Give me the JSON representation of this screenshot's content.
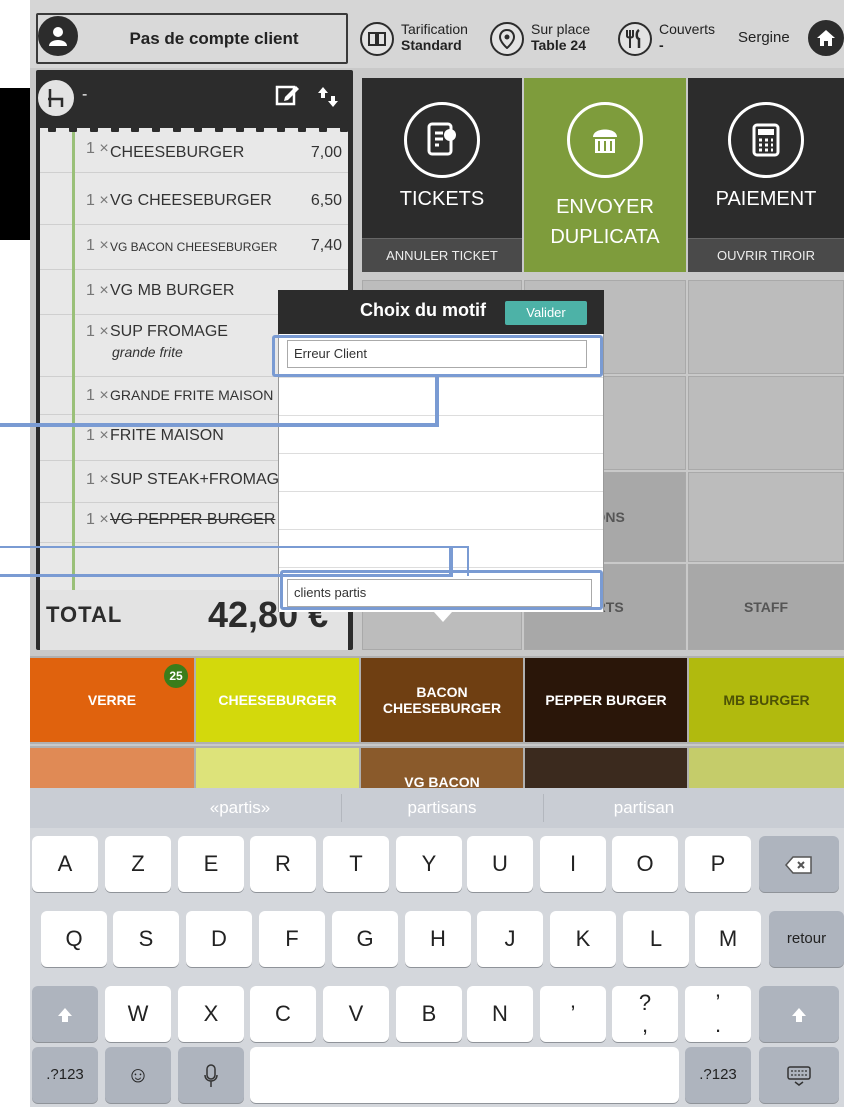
{
  "header": {
    "client_label": "Pas de compte client",
    "tarification_label": "Tarification",
    "tarification_value": "Standard",
    "service_label": "Sur place",
    "service_value": "Table 24",
    "couverts_label": "Couverts",
    "couverts_value": "-",
    "user_name": "Sergine"
  },
  "ticket": {
    "table_value": "-",
    "items": [
      {
        "qty": "1 ×",
        "name": "CHEESEBURGER",
        "price": "7,00"
      },
      {
        "qty": "1 ×",
        "name": "VG CHEESEBURGER",
        "price": "6,50"
      },
      {
        "qty": "1 ×",
        "name": "VG BACON CHEESEBURGER",
        "price": "7,40"
      },
      {
        "qty": "1 ×",
        "name": "VG MB BURGER",
        "price": ""
      },
      {
        "qty": "1 ×",
        "name": "SUP FROMAGE",
        "note": "grande frite",
        "price": ""
      },
      {
        "qty": "1 ×",
        "name": "GRANDE FRITE MAISON",
        "price": ""
      },
      {
        "qty": "1 ×",
        "name": "FRITE MAISON",
        "price": ""
      },
      {
        "qty": "1 ×",
        "name": "SUP STEAK+FROMAGE",
        "price": ""
      },
      {
        "qty": "1 ×",
        "name": "VG PEPPER BURGER",
        "price": ""
      }
    ],
    "total_label": "TOTAL",
    "total_value": "42,80 €"
  },
  "actions": {
    "tickets_label": "TICKETS",
    "annuler_label": "ANNULER TICKET",
    "envoyer_label_1": "ENVOYER",
    "envoyer_label_2": "DUPLICATA",
    "paiement_label": "PAIEMENT",
    "tiroir_label": "OUVRIR TIROIR"
  },
  "grid": {
    "boissons_partial": "SONS",
    "desserts_partial": "ERTS",
    "staff_label": "STAFF"
  },
  "products": [
    {
      "label": "VERRE",
      "badge": "25",
      "color": "#e0620d"
    },
    {
      "label": "CHEESEBURGER",
      "color": "#d3d90c"
    },
    {
      "label": "BACON\nCHEESEBURGER",
      "color": "#6f3f12"
    },
    {
      "label": "PEPPER BURGER",
      "color": "#2a1609"
    },
    {
      "label": "MB BURGER",
      "color": "#b1ba0e"
    }
  ],
  "products_row2": [
    {
      "label": "",
      "color": "#e08a55"
    },
    {
      "label": "",
      "color": "#dde37a"
    },
    {
      "label": "VG BACON",
      "color": "#8a5a2b"
    },
    {
      "label": "",
      "color": "#3b2a1e"
    },
    {
      "label": "",
      "color": "#c5cc6a"
    }
  ],
  "popup": {
    "title": "Choix du motif",
    "valider_label": "Valider",
    "field_top_value": "Erreur Client",
    "field_bottom_value": "clients partis"
  },
  "keyboard": {
    "suggestions": [
      "«partis»",
      "partisans",
      "partisan"
    ],
    "row1": [
      "A",
      "Z",
      "E",
      "R",
      "T",
      "Y",
      "U",
      "I",
      "O",
      "P"
    ],
    "row2": [
      "Q",
      "S",
      "D",
      "F",
      "G",
      "H",
      "J",
      "K",
      "L",
      "M"
    ],
    "row3": [
      "W",
      "X",
      "C",
      "V",
      "B",
      "N",
      "’",
      "?\n,",
      "’\n."
    ],
    "return_label": "retour",
    "numbers_label": ".?123",
    "emoji_label": "☺",
    "mic_label": "🎙"
  },
  "colors": {
    "dark": "#2c2c2c",
    "green": "#7e9c3c",
    "teal": "#4db2a7",
    "highlight": "#7a9bd3"
  }
}
